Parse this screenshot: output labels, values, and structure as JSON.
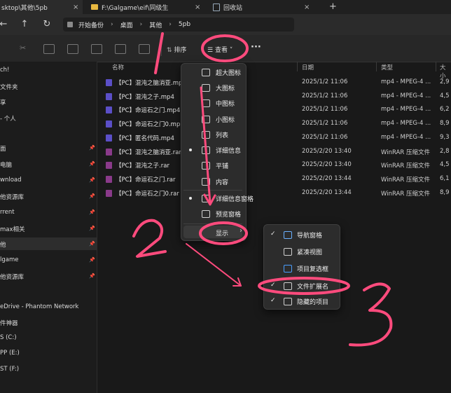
{
  "tabs": [
    {
      "label": "sktop\\其他\\5pb"
    },
    {
      "label": "F:\\Galgame\\eif\\同级生"
    },
    {
      "label": "回收站"
    }
  ],
  "breadcrumb": [
    "开始备份",
    "桌面",
    "其他",
    "5pb"
  ],
  "toolbar": {
    "sort_label": "排序",
    "view_label": "查看",
    "more_label": "···"
  },
  "sidebar": [
    {
      "label": "ch!",
      "pinned": false
    },
    {
      "label": "文件夹",
      "pinned": false
    },
    {
      "label": "享",
      "pinned": false
    },
    {
      "label": "- 个人",
      "pinned": false
    },
    {
      "label": "面",
      "pinned": true
    },
    {
      "label": "电脑",
      "pinned": true
    },
    {
      "label": "wnload",
      "pinned": true
    },
    {
      "label": "他资源库",
      "pinned": true
    },
    {
      "label": "rrent",
      "pinned": true
    },
    {
      "label": "max相关",
      "pinned": true
    },
    {
      "label": "他",
      "pinned": true
    },
    {
      "label": "lgame",
      "pinned": true
    },
    {
      "label": "他资源库",
      "pinned": true
    },
    {
      "label": "eDrive - Phantom Network",
      "pinned": false
    },
    {
      "label": "件神器",
      "pinned": false
    },
    {
      "label": "S (C:)",
      "pinned": false
    },
    {
      "label": "PP (E:)",
      "pinned": false
    },
    {
      "label": "ST (F:)",
      "pinned": false
    }
  ],
  "columns": {
    "name": "名称",
    "date": "日期",
    "type": "类型",
    "size": "大小"
  },
  "files": [
    {
      "name": "【PC】混沌之脑消亚.mp",
      "date": "2025/1/2 11:06",
      "type": "mp4 - MPEG-4 ...",
      "size": "2,9",
      "kind": "mp4"
    },
    {
      "name": "【PC】混沌之子.mp4",
      "date": "2025/1/2 11:06",
      "type": "mp4 - MPEG-4 ...",
      "size": "4,5",
      "kind": "mp4"
    },
    {
      "name": "【PC】命运石之门.mp4",
      "date": "2025/1/2 11:06",
      "type": "mp4 - MPEG-4 ...",
      "size": "6,2",
      "kind": "mp4"
    },
    {
      "name": "【PC】命运石之门0.mp",
      "date": "2025/1/2 11:06",
      "type": "mp4 - MPEG-4 ...",
      "size": "8,9",
      "kind": "mp4"
    },
    {
      "name": "【PC】匿名代码.mp4",
      "date": "2025/1/2 11:06",
      "type": "mp4 - MPEG-4 ...",
      "size": "9,3",
      "kind": "mp4"
    },
    {
      "name": "【PC】混沌之脑消亚.rar",
      "date": "2025/2/20 13:40",
      "type": "WinRAR 压缩文件",
      "size": "2,8",
      "kind": "rar"
    },
    {
      "name": "【PC】混沌之子.rar",
      "date": "2025/2/20 13:40",
      "type": "WinRAR 压缩文件",
      "size": "4,5",
      "kind": "rar"
    },
    {
      "name": "【PC】命运石之门.rar",
      "date": "2025/2/20 13:44",
      "type": "WinRAR 压缩文件",
      "size": "6,1",
      "kind": "rar"
    },
    {
      "name": "【PC】命运石之门0.rar",
      "date": "2025/2/20 13:44",
      "type": "WinRAR 压缩文件",
      "size": "8,9",
      "kind": "rar"
    }
  ],
  "view_menu": [
    {
      "label": "超大图标",
      "icon": "extra-large-icons-icon",
      "selected": false
    },
    {
      "label": "大图标",
      "icon": "large-icons-icon",
      "selected": false
    },
    {
      "label": "中图标",
      "icon": "medium-icons-icon",
      "selected": false
    },
    {
      "label": "小图标",
      "icon": "small-icons-icon",
      "selected": false
    },
    {
      "label": "列表",
      "icon": "list-icon",
      "selected": false
    },
    {
      "label": "详细信息",
      "icon": "details-icon",
      "selected": true
    },
    {
      "label": "平铺",
      "icon": "tiles-icon",
      "selected": false
    },
    {
      "label": "内容",
      "icon": "content-icon",
      "selected": false
    },
    {
      "label": "详细信息窗格",
      "icon": "details-pane-icon",
      "selected": true
    },
    {
      "label": "预览窗格",
      "icon": "preview-pane-icon",
      "selected": false
    },
    {
      "label": "显示",
      "icon": "",
      "selected": false
    }
  ],
  "show_menu": [
    {
      "label": "导航窗格",
      "icon": "navigation-pane-icon",
      "checked": true
    },
    {
      "label": "紧凑视图",
      "icon": "compact-view-icon",
      "checked": false
    },
    {
      "label": "项目复选框",
      "icon": "item-checkbox-icon",
      "checked": false
    },
    {
      "label": "文件扩展名",
      "icon": "file-extension-icon",
      "checked": true
    },
    {
      "label": "隐藏的项目",
      "icon": "hidden-items-icon",
      "checked": true
    }
  ],
  "annotations": [
    "1",
    "2",
    "3"
  ],
  "colors": {
    "annotation": "#ff4b7d",
    "mp4_icon": "#5b4fc7",
    "rar_icon": "#8a3a8a",
    "background": "#191919"
  }
}
